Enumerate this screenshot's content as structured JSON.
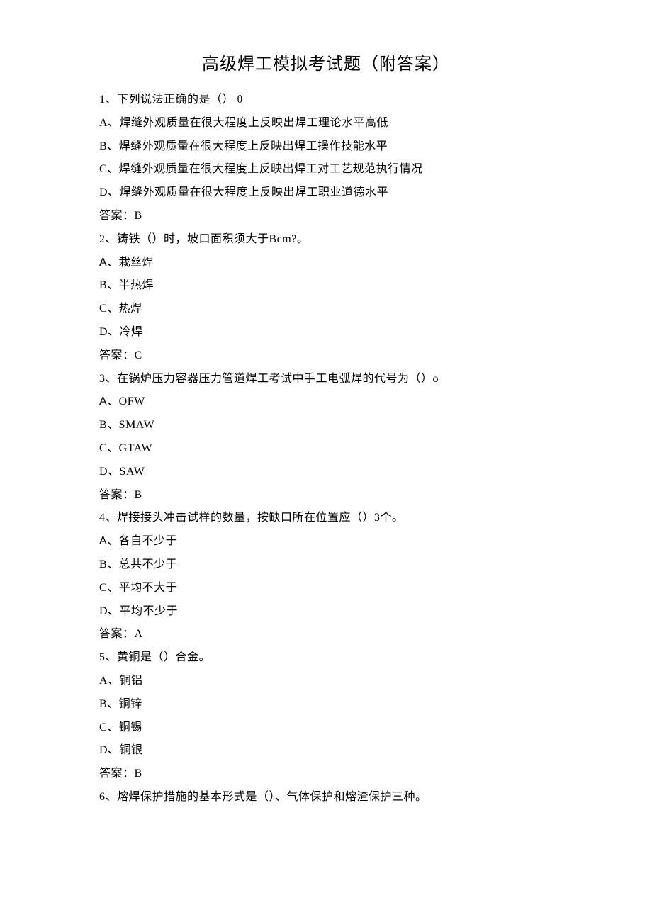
{
  "title": "高级焊工模拟考试题（附答案）",
  "questions": [
    {
      "stem": "1、下列说法正确的是（） θ",
      "options": [
        "A、焊缝外观质量在很大程度上反映出焊工理论水平高低",
        "B、焊缝外观质量在很大程度上反映出焊工操作技能水平",
        "C、焊缝外观质量在很大程度上反映出焊工对工艺规范执行情况",
        "D、焊缝外观质量在很大程度上反映出焊工职业道德水平"
      ],
      "answer": "答案：B"
    },
    {
      "stem": "2、铸铁（）时，坡口面积须大于Bcm?。",
      "options": [
        "A、栽丝焊",
        "B、半热焊",
        "C、热焊",
        "D、冷焊"
      ],
      "answer": "答案：C"
    },
    {
      "stem": "3、在锅炉压力容器压力管道焊工考试中手工电弧焊的代号为（）o",
      "options": [
        "A、OFW",
        "B、SMAW",
        "C、GTAW",
        "D、SAW"
      ],
      "answer": "答案：B"
    },
    {
      "stem": "4、焊接接头冲击试样的数量，按缺口所在位置应（）3个。",
      "options": [
        "A、各自不少于",
        "B、总共不少于",
        "C、平均不大于",
        "D、平均不少于"
      ],
      "answer": "答案：A"
    },
    {
      "stem": "5、黄铜是（）合金。",
      "options": [
        "A、铜铝",
        "B、铜锌",
        "C、铜锡",
        "D、铜银"
      ],
      "answer": "答案：B"
    },
    {
      "stem": "6、熔焊保护措施的基本形式是（）、气体保护和熔渣保护三种。",
      "options": [],
      "answer": null
    }
  ]
}
